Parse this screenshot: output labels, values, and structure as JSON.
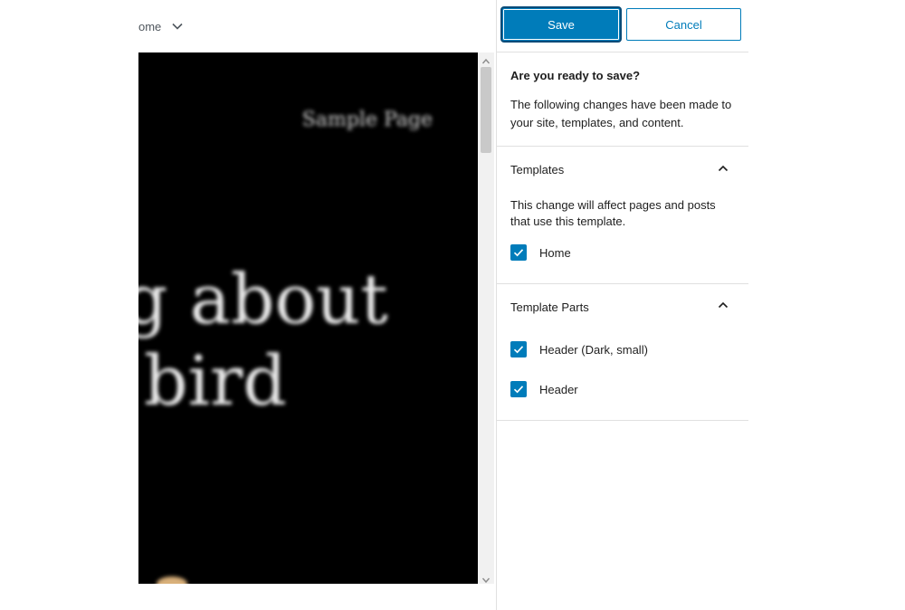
{
  "template_selector": {
    "label": "ome",
    "icon": "chevron-down-icon"
  },
  "preview": {
    "nav_link": "Sample Page",
    "hero_line1": "og about",
    "hero_line2": "bird"
  },
  "save_panel": {
    "save_label": "Save",
    "cancel_label": "Cancel",
    "intro_title": "Are you ready to save?",
    "intro_text": "The following changes have been made to your site, templates, and content.",
    "sections": [
      {
        "title": "Templates",
        "description": "This change will affect pages and posts that use this template.",
        "items": [
          {
            "label": "Home",
            "checked": true
          }
        ]
      },
      {
        "title": "Template Parts",
        "items": [
          {
            "label": "Header (Dark, small)",
            "checked": true
          },
          {
            "label": "Header",
            "checked": true
          }
        ]
      }
    ]
  },
  "colors": {
    "accent": "#007cba",
    "canvas_bg": "#000000",
    "divider": "#e0e0e0"
  }
}
